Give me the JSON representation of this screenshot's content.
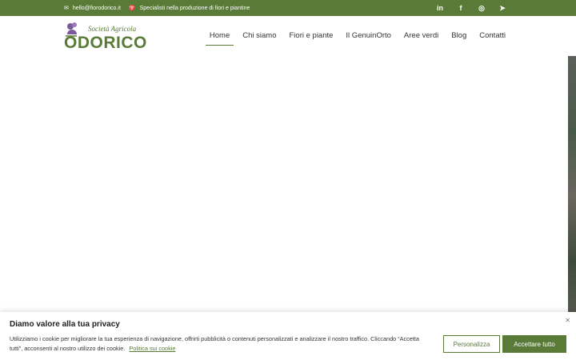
{
  "topbar": {
    "email": "hello@fiorodorico.it",
    "tagline": "Specialisti nella produzione di fiori e piantine",
    "social": [
      "linkedin-icon",
      "facebook-icon",
      "instagram-icon",
      "telegram-icon"
    ]
  },
  "logo": {
    "subtitle": "Società Agricola",
    "name": "ODORICO"
  },
  "nav": {
    "items": [
      "Home",
      "Chi siamo",
      "Fiori e piante",
      "Il GenuinOrto",
      "Aree verdi",
      "Blog",
      "Contatti"
    ],
    "active": "Home"
  },
  "cookie": {
    "title": "Diamo valore alla tua privacy",
    "text": "Utilizziamo i cookie per migliorare la tua esperienza di navigazione, offrirti pubblicità o contenuti personalizzati e analizzare il nostro traffico. Cliccando “Accetta tutti”, acconsenti al nostro utilizzo dei cookie.",
    "policy_link": "Politica sui cookie",
    "customize_label": "Personalizza",
    "accept_label": "Accettare tutto",
    "close_symbol": "✕"
  },
  "colors": {
    "brand_green": "#5a7a38",
    "logo_purple": "#7a5a9a"
  }
}
